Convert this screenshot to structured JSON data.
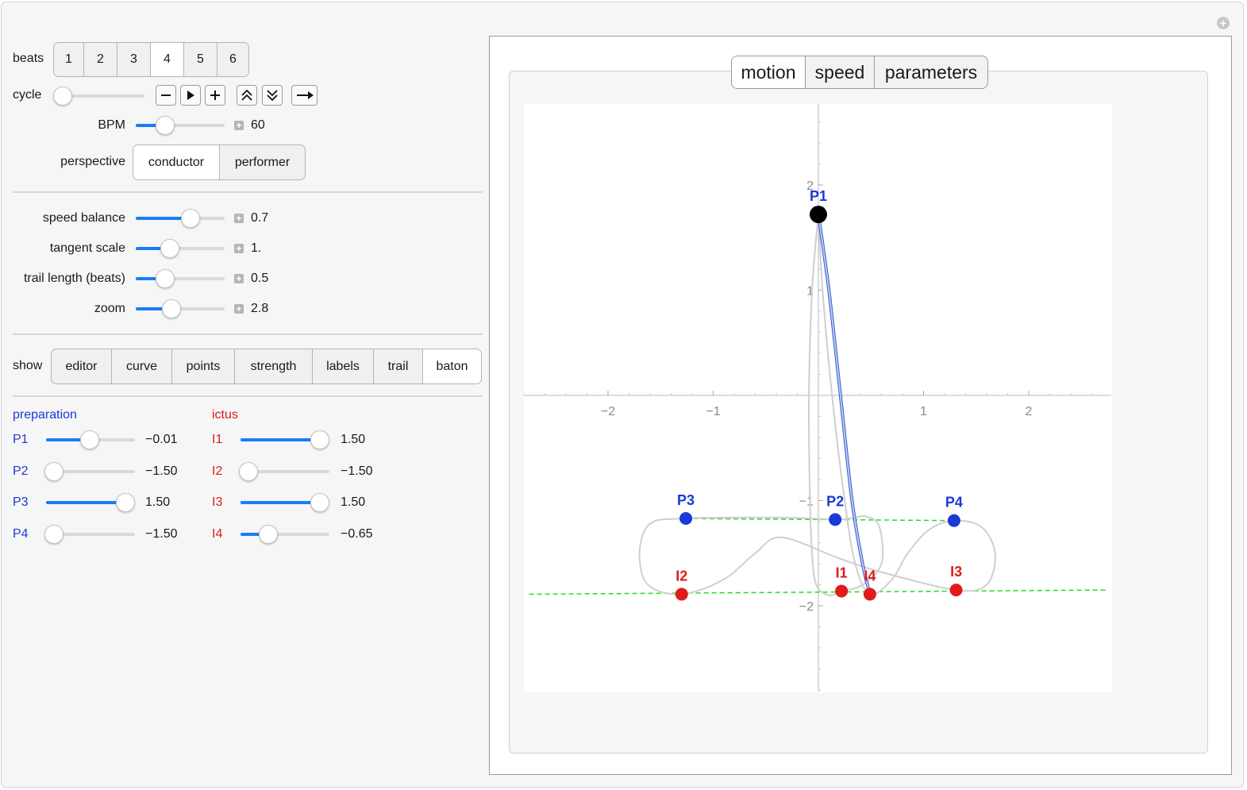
{
  "beats": {
    "label": "beats",
    "options": [
      "1",
      "2",
      "3",
      "4",
      "5",
      "6"
    ],
    "selected": "4"
  },
  "cycle": {
    "label": "cycle",
    "value": 0
  },
  "bpm": {
    "label": "BPM",
    "value": "60",
    "fraction": 0.3
  },
  "perspective": {
    "label": "perspective",
    "options": [
      "conductor",
      "performer"
    ],
    "selected": "conductor"
  },
  "sliders": [
    {
      "label": "speed balance",
      "value": "0.7",
      "fraction": 0.66
    },
    {
      "label": "tangent scale",
      "value": "1.",
      "fraction": 0.37
    },
    {
      "label": "trail length (beats)",
      "value": "0.5",
      "fraction": 0.3
    },
    {
      "label": "zoom",
      "value": "2.8",
      "fraction": 0.39
    }
  ],
  "show": {
    "label": "show",
    "options": [
      "editor",
      "curve",
      "points",
      "strength",
      "labels",
      "trail",
      "baton"
    ],
    "selected": "baton"
  },
  "preparation": {
    "heading": "preparation",
    "items": [
      {
        "label": "P1",
        "value": "−0.01",
        "fraction": 0.5
      },
      {
        "label": "P2",
        "value": "−1.50",
        "fraction": 0.0
      },
      {
        "label": "P3",
        "value": "1.50",
        "fraction": 1.0
      },
      {
        "label": "P4",
        "value": "−1.50",
        "fraction": 0.0
      }
    ]
  },
  "ictus": {
    "heading": "ictus",
    "items": [
      {
        "label": "I1",
        "value": "1.50",
        "fraction": 1.0
      },
      {
        "label": "I2",
        "value": "−1.50",
        "fraction": 0.0
      },
      {
        "label": "I3",
        "value": "1.50",
        "fraction": 1.0
      },
      {
        "label": "I4",
        "value": "−0.65",
        "fraction": 0.28
      }
    ]
  },
  "view_tabs": {
    "options": [
      "motion",
      "speed",
      "parameters"
    ],
    "selected": "motion"
  },
  "colors": {
    "accent": "#1a7df7",
    "preparation": "#1a3bd6",
    "ictus": "#e01b1b",
    "guide": "#22dd22",
    "baton": "#000000"
  },
  "chart_data": {
    "type": "scatter",
    "xlim": [
      -2.8,
      2.8
    ],
    "ylim": [
      -2.8,
      2.8
    ],
    "x_ticks": [
      "−2",
      "−1",
      "1",
      "2"
    ],
    "y_ticks": [
      "2",
      "1",
      "−1",
      "−2"
    ],
    "points": [
      {
        "name": "P1",
        "x": 0.0,
        "y": 1.72,
        "group": "baton"
      },
      {
        "name": "P2",
        "x": 0.16,
        "y": -1.18,
        "group": "preparation"
      },
      {
        "name": "P3",
        "x": -1.26,
        "y": -1.17,
        "group": "preparation"
      },
      {
        "name": "P4",
        "x": 1.29,
        "y": -1.19,
        "group": "preparation"
      },
      {
        "name": "I1",
        "x": 0.22,
        "y": -1.86,
        "group": "ictus"
      },
      {
        "name": "I2",
        "x": -1.3,
        "y": -1.89,
        "group": "ictus"
      },
      {
        "name": "I3",
        "x": 1.31,
        "y": -1.85,
        "group": "ictus"
      },
      {
        "name": "I4",
        "x": 0.49,
        "y": -1.89,
        "group": "ictus"
      }
    ],
    "curve_path": [
      [
        0.0,
        1.72
      ],
      [
        -0.06,
        1.0
      ],
      [
        -0.09,
        0.0
      ],
      [
        -0.08,
        -1.0
      ],
      [
        -0.06,
        -1.5
      ],
      [
        -0.02,
        -1.8
      ],
      [
        0.1,
        -1.9
      ],
      [
        0.22,
        -1.86
      ],
      [
        0.42,
        -1.8
      ],
      [
        0.6,
        -1.6
      ],
      [
        0.58,
        -1.25
      ],
      [
        0.45,
        -1.15
      ],
      [
        0.3,
        -1.17
      ],
      [
        0.16,
        -1.18
      ],
      [
        -0.4,
        -1.16
      ],
      [
        -1.26,
        -1.17
      ],
      [
        -1.6,
        -1.22
      ],
      [
        -1.7,
        -1.5
      ],
      [
        -1.62,
        -1.8
      ],
      [
        -1.3,
        -1.89
      ],
      [
        -0.9,
        -1.75
      ],
      [
        -0.6,
        -1.5
      ],
      [
        -0.35,
        -1.35
      ],
      [
        0.2,
        -1.55
      ],
      [
        0.6,
        -1.68
      ],
      [
        1.31,
        -1.85
      ],
      [
        1.6,
        -1.8
      ],
      [
        1.68,
        -1.5
      ],
      [
        1.55,
        -1.25
      ],
      [
        1.29,
        -1.19
      ],
      [
        1.05,
        -1.28
      ],
      [
        0.85,
        -1.5
      ],
      [
        0.7,
        -1.75
      ],
      [
        0.49,
        -1.89
      ],
      [
        0.35,
        -1.6
      ],
      [
        0.25,
        -1.0
      ],
      [
        0.13,
        0.0
      ],
      [
        0.04,
        1.0
      ],
      [
        0.0,
        1.72
      ]
    ],
    "baton_path": [
      [
        0.0,
        1.72
      ],
      [
        0.1,
        1.0
      ],
      [
        0.21,
        0.0
      ],
      [
        0.32,
        -1.0
      ],
      [
        0.42,
        -1.6
      ],
      [
        0.49,
        -1.89
      ]
    ],
    "guide_lines": [
      {
        "from": [
          -1.26,
          -1.17
        ],
        "to": [
          1.29,
          -1.19
        ]
      },
      {
        "from": [
          -2.75,
          -1.89
        ],
        "to": [
          2.75,
          -1.85
        ]
      }
    ]
  }
}
